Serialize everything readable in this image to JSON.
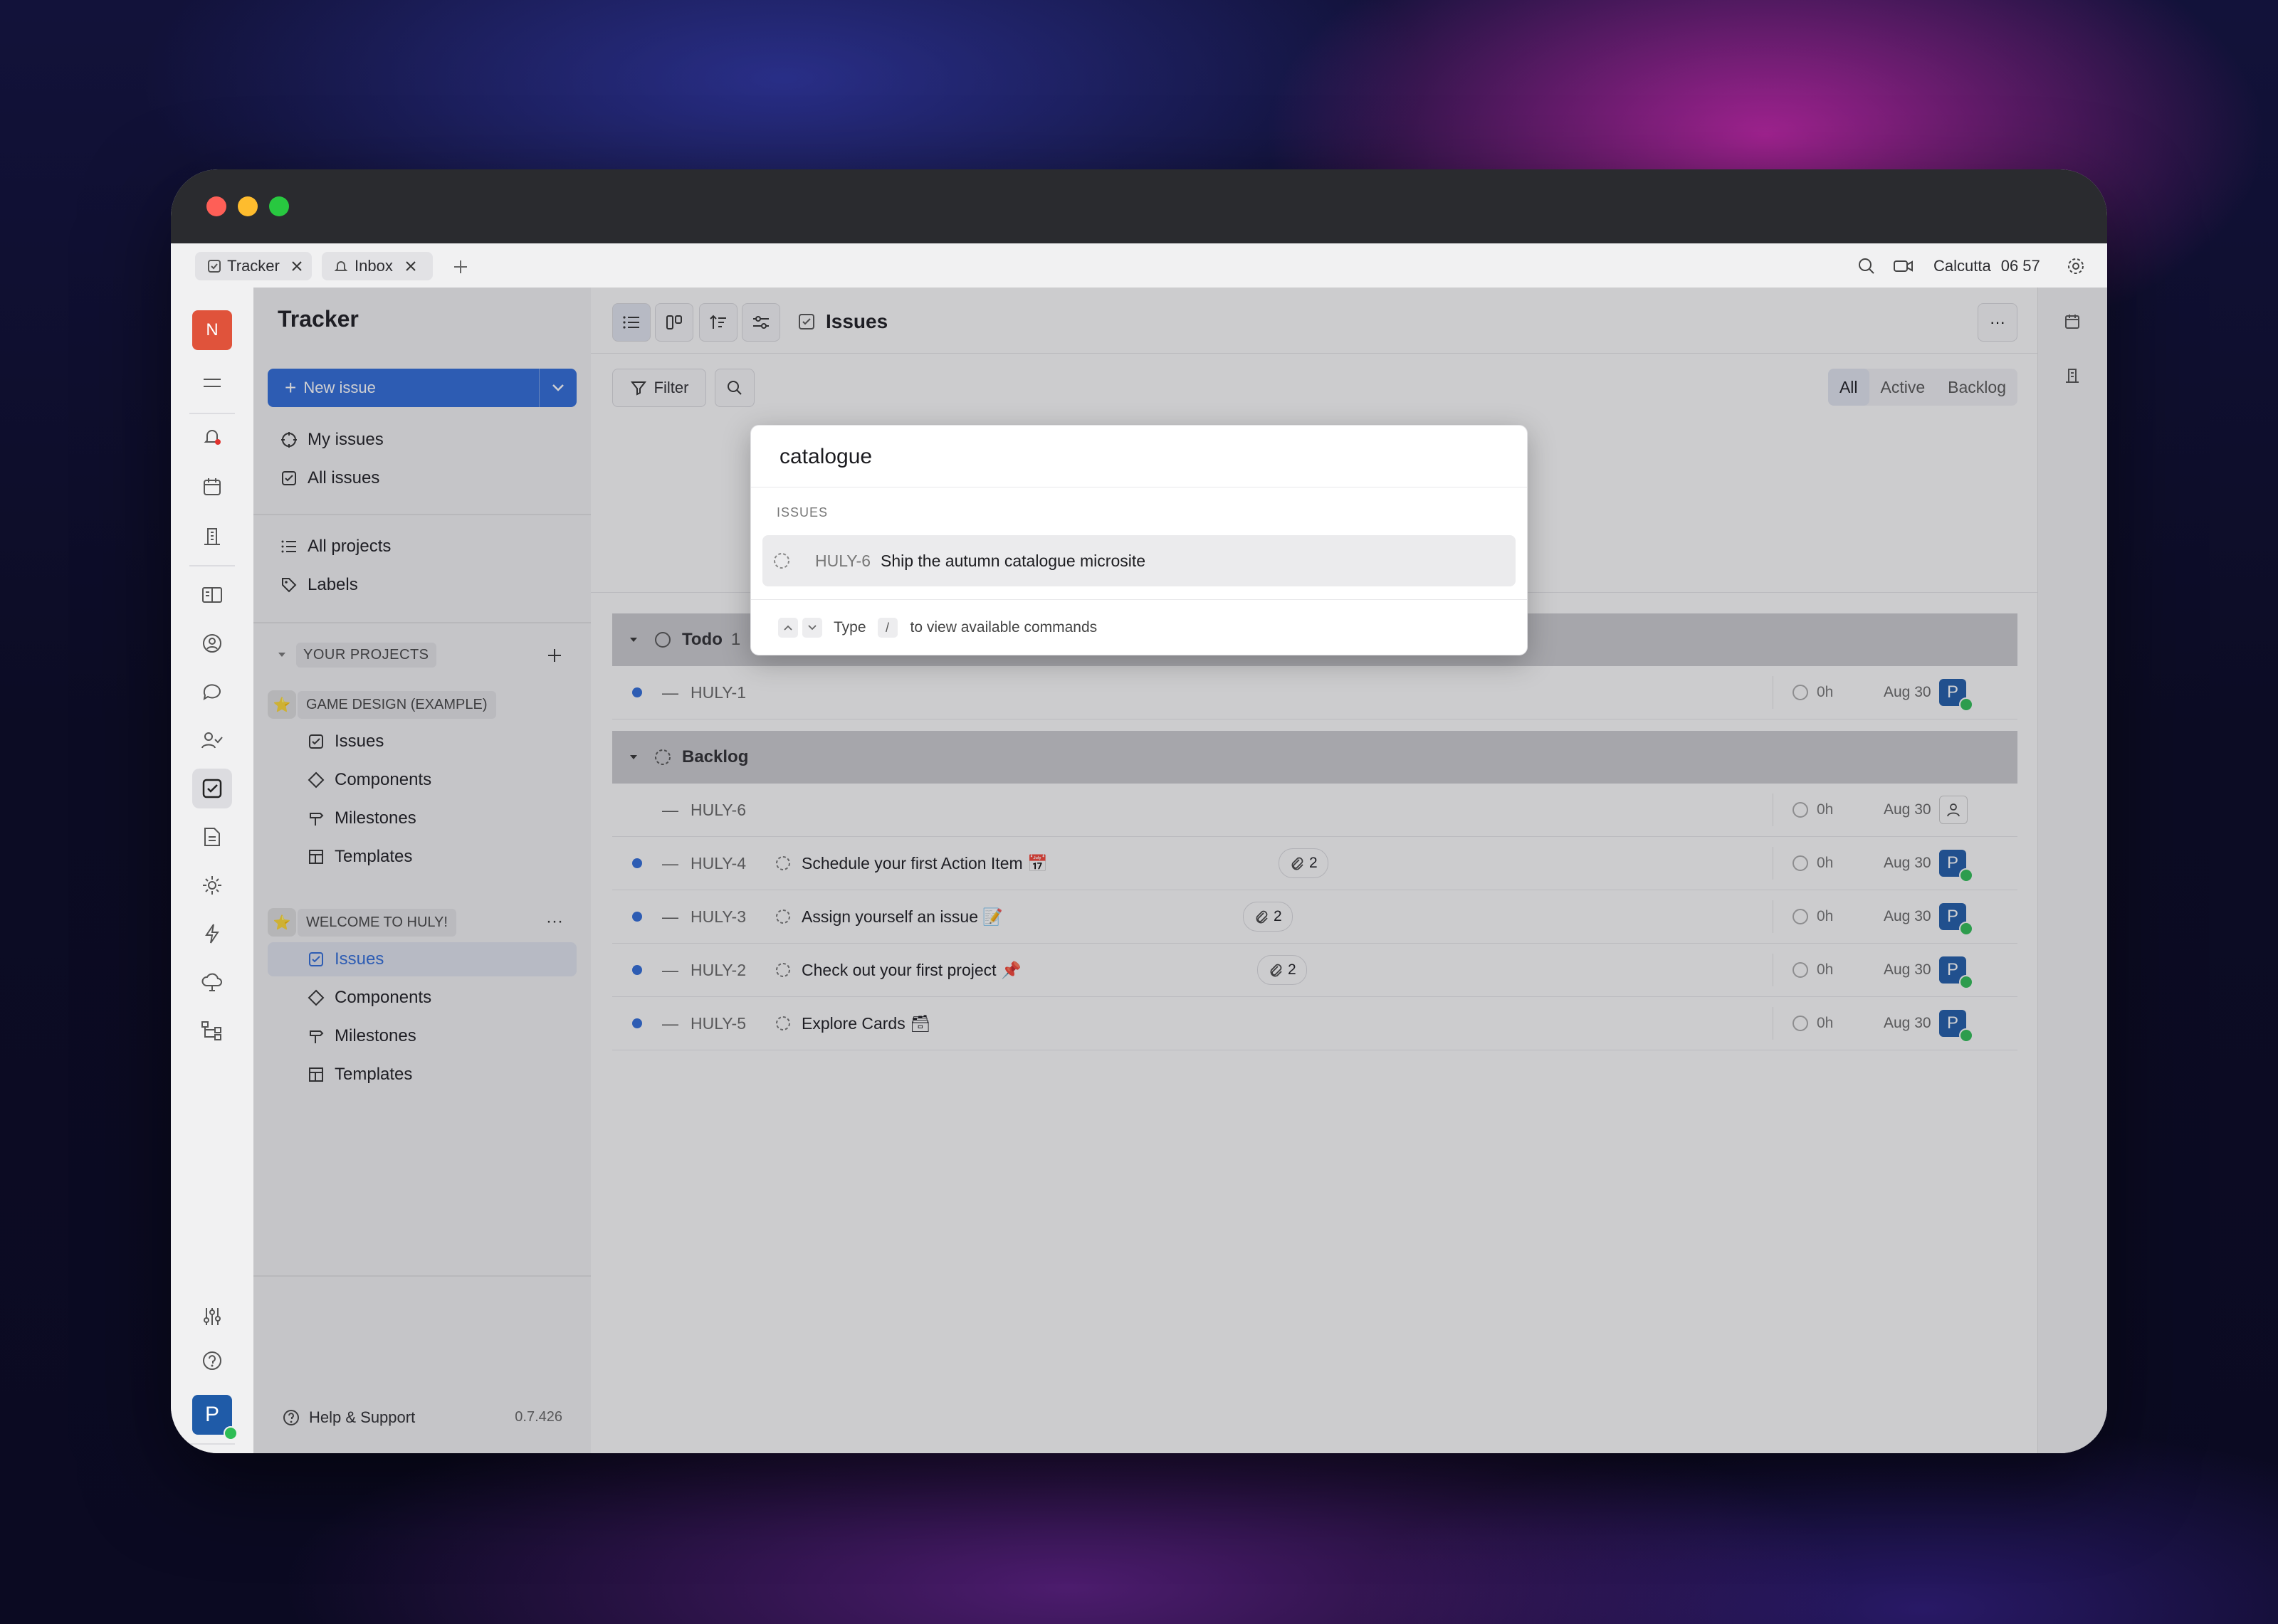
{
  "tabs": [
    {
      "label": "Tracker",
      "icon": "checkbox-icon"
    },
    {
      "label": "Inbox",
      "icon": "bell-icon"
    }
  ],
  "topbar": {
    "location": "Calcutta",
    "time": "06 57"
  },
  "workspace": {
    "initial": "N",
    "color": "#e0533b"
  },
  "user": {
    "initial": "P",
    "color": "#1f5ba8"
  },
  "sidebar": {
    "title": "Tracker",
    "new_issue": "New issue",
    "nav": [
      "My issues",
      "All issues",
      "All projects",
      "Labels"
    ],
    "section_title": "YOUR PROJECTS",
    "projects": [
      {
        "name": "GAME DESIGN (EXAMPLE)",
        "items": [
          "Issues",
          "Components",
          "Milestones",
          "Templates"
        ]
      },
      {
        "name": "WELCOME TO HULY!",
        "items": [
          "Issues",
          "Components",
          "Milestones",
          "Templates"
        ]
      }
    ],
    "help": "Help & Support",
    "version": "0.7.426"
  },
  "main": {
    "title": "Issues",
    "filter": "Filter",
    "modes": [
      "All",
      "Active",
      "Backlog"
    ],
    "groups": [
      {
        "label": "Todo",
        "count": "1"
      },
      {
        "label": "Backlog"
      }
    ],
    "rows": [
      {
        "id": "HULY-1",
        "title": "",
        "estimate": "0h",
        "due": "Aug 30",
        "assignee": "P"
      },
      {
        "id": "HULY-6",
        "title": "",
        "estimate": "0h",
        "due": "Aug 30",
        "assignee": ""
      },
      {
        "id": "HULY-4",
        "title": "Schedule your first Action Item 📅",
        "attachments": "2",
        "estimate": "0h",
        "due": "Aug 30",
        "assignee": "P"
      },
      {
        "id": "HULY-3",
        "title": "Assign yourself an issue 📝",
        "attachments": "2",
        "estimate": "0h",
        "due": "Aug 30",
        "assignee": "P"
      },
      {
        "id": "HULY-2",
        "title": "Check out your first project 📌",
        "attachments": "2",
        "estimate": "0h",
        "due": "Aug 30",
        "assignee": "P"
      },
      {
        "id": "HULY-5",
        "title": "Explore Cards 🗃",
        "estimate": "0h",
        "due": "Aug 30",
        "assignee": "P"
      }
    ]
  },
  "popup": {
    "query": "catalogue",
    "category": "ISSUES",
    "result": {
      "id": "HULY-6",
      "title": "Ship the autumn catalogue microsite"
    },
    "footer": {
      "type_label": "Type",
      "key": "/",
      "hint": "to view available commands"
    }
  }
}
